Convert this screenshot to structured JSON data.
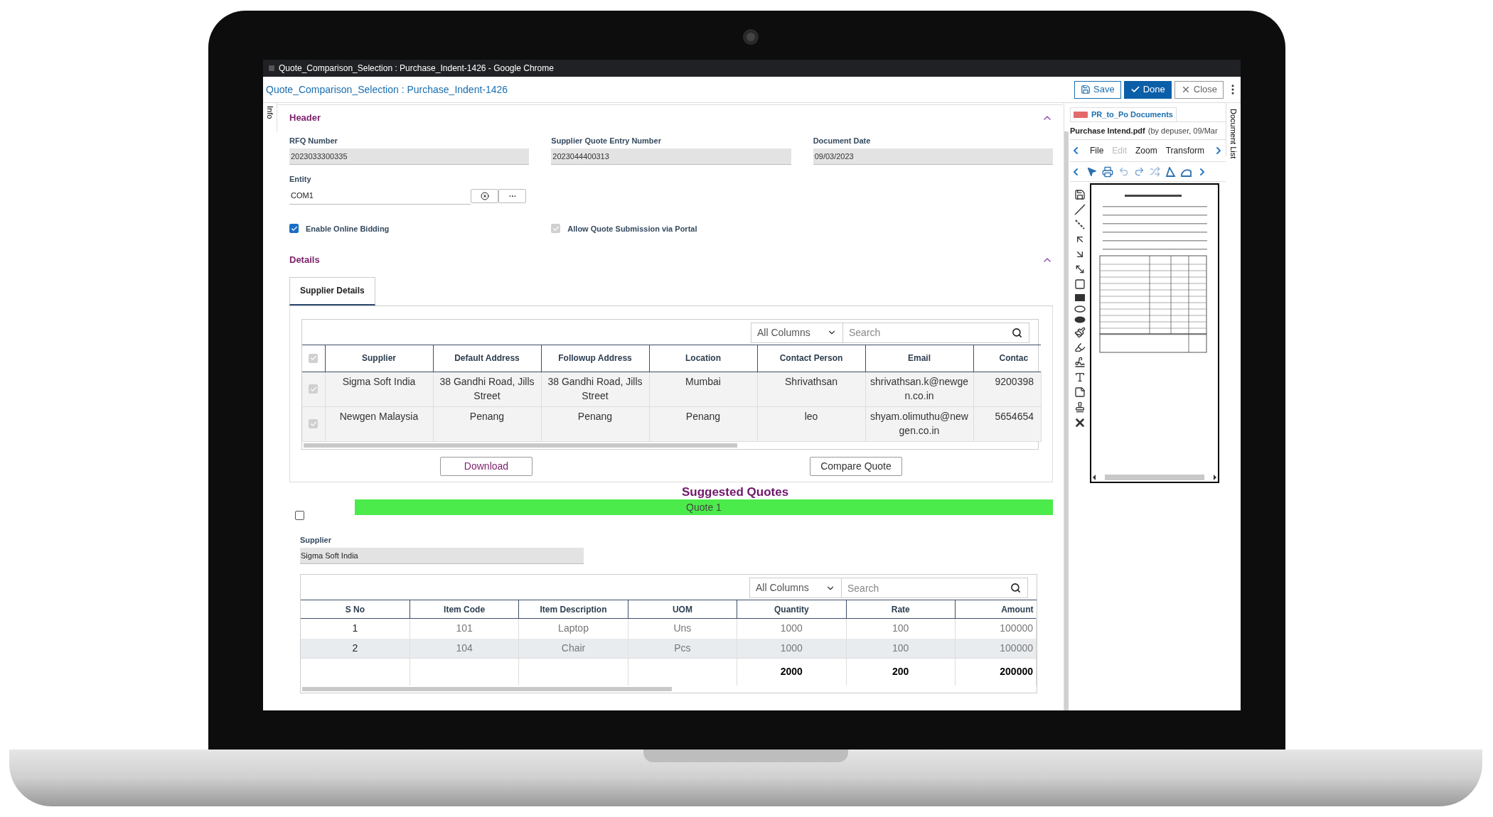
{
  "browser": {
    "title": "Quote_Comparison_Selection : Purchase_Indent-1426 - Google Chrome"
  },
  "app": {
    "title": "Quote_Comparison_Selection : Purchase_Indent-1426",
    "buttons": [
      {
        "label": "Save",
        "kind": "save"
      },
      {
        "label": "Done",
        "kind": "primary"
      },
      {
        "label": "Close",
        "kind": "close"
      }
    ]
  },
  "side_tab": {
    "label": "Info"
  },
  "header": {
    "title": "Header",
    "expanded": true,
    "fields": [
      {
        "label": "RFQ Number",
        "value": "2023033300335"
      },
      {
        "label": "Supplier Quote Entry Number",
        "value": "2023044400313"
      },
      {
        "label": "Document Date",
        "value": "09/03/2023"
      }
    ],
    "entity": {
      "label": "Entity",
      "value": "COM1"
    },
    "checkboxes": [
      {
        "label": "Enable Online Bidding",
        "checked": true,
        "disabled": false
      },
      {
        "label": "Allow Quote Submission via Portal",
        "checked": true,
        "disabled": true
      }
    ]
  },
  "details": {
    "title": "Details",
    "expanded": true,
    "tabs": [
      {
        "label": "Supplier Details",
        "selected": true
      }
    ],
    "supplier_grid": {
      "filter": "All Columns",
      "search_placeholder": "Search",
      "header_checked": true,
      "columns": [
        "Supplier",
        "Default Address",
        "Followup Address",
        "Location",
        "Contact Person",
        "Email",
        "Contac"
      ],
      "rows": [
        {
          "checked": true,
          "cells": [
            "Sigma Soft India",
            "38 Gandhi Road, Jills Street",
            "38 Gandhi Road, Jills Street",
            "Mumbai",
            "Shrivathsan",
            "shrivathsan.k@newgen.co.in",
            "9200398"
          ]
        },
        {
          "checked": true,
          "cells": [
            "Newgen Malaysia",
            "Penang",
            "Penang",
            "Penang",
            "leo",
            "shyam.olimuthu@newgen.co.in",
            "5654654"
          ]
        }
      ]
    },
    "buttons": [
      {
        "label": "Download",
        "kind": "accent"
      },
      {
        "label": "Compare Quote",
        "kind": "plain"
      }
    ]
  },
  "suggested_quotes": {
    "title": "Suggested Quotes",
    "quote": {
      "label": "Quote 1",
      "checked": false
    },
    "supplier": {
      "label": "Supplier",
      "value": "Sigma Soft India"
    },
    "items_grid": {
      "filter": "All Columns",
      "search_placeholder": "Search",
      "columns": [
        "S No",
        "Item Code",
        "Item Description",
        "UOM",
        "Quantity",
        "Rate",
        "Amount"
      ],
      "rows": [
        [
          "1",
          "101",
          "Laptop",
          "Uns",
          "1000",
          "100",
          "100000"
        ],
        [
          "2",
          "104",
          "Chair",
          "Pcs",
          "1000",
          "100",
          "100000"
        ]
      ],
      "totals": {
        "quantity": "2000",
        "rate": "200",
        "amount": "200000"
      }
    }
  },
  "document_panel": {
    "tab": "PR_to_Po Documents",
    "file": "Purchase Intend.pdf",
    "meta": "(by depuser, 09/Mar",
    "menu": [
      {
        "label": "File",
        "disabled": false
      },
      {
        "label": "Edit",
        "disabled": true
      },
      {
        "label": "Zoom",
        "disabled": false
      },
      {
        "label": "Transform",
        "disabled": false
      }
    ]
  },
  "right_tab": {
    "label": "Document List"
  }
}
